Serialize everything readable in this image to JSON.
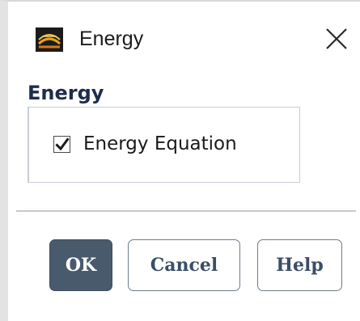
{
  "window": {
    "title": "Energy",
    "icon": "fluent-app-icon",
    "close_icon": "close-icon"
  },
  "section": {
    "title": "Energy"
  },
  "energy_equation": {
    "label": "Energy Equation",
    "checked": true
  },
  "buttons": {
    "ok": "OK",
    "cancel": "Cancel",
    "help": "Help"
  },
  "colors": {
    "primary_button": "#4a5a6d",
    "section_title": "#1c2e4c",
    "button_text": "#3b4e66"
  }
}
